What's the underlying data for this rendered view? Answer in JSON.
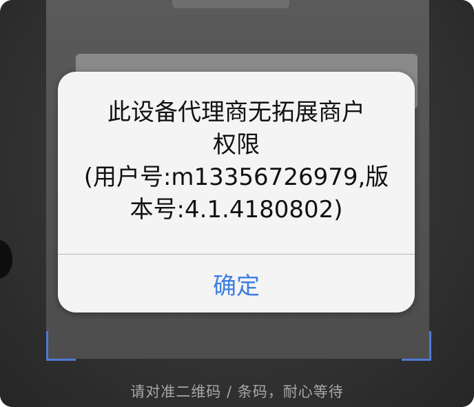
{
  "dialog": {
    "message": "此设备代理商无拓展商户\n权限\n(用户号:m13356726979,版\n本号:4.1.4180802)",
    "ok_label": "确定"
  },
  "scanner": {
    "hint": "请对准二维码 / 条码，耐心等待"
  },
  "colors": {
    "accent": "#3d7ee0",
    "scan_corner": "#4f7ad6",
    "dialog_bg": "#f4f4f4",
    "hint_text": "#a8a8a8"
  }
}
